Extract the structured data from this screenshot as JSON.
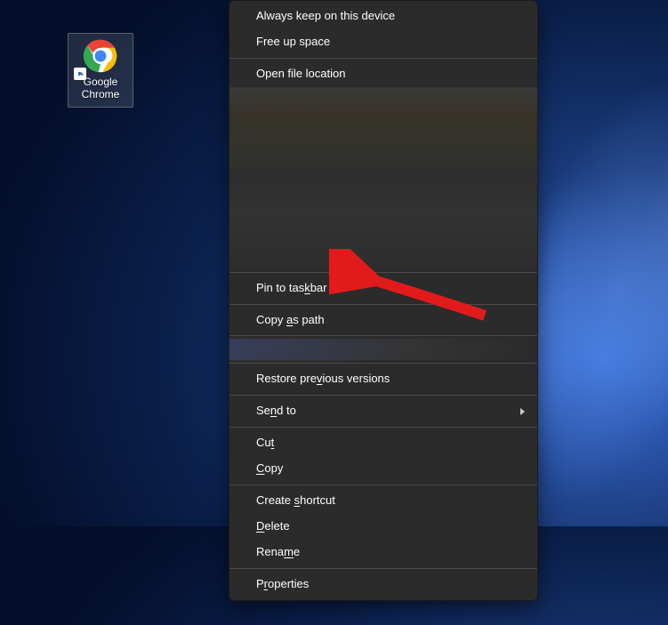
{
  "desktop": {
    "icon_label_line1": "Google",
    "icon_label_line2": "Chrome"
  },
  "context_menu": {
    "items": [
      {
        "label": "Always keep on this device",
        "mnemonic": null
      },
      {
        "label": "Free up space",
        "mnemonic": null
      },
      "sep",
      {
        "label": "Open file location",
        "mnemonic": null
      },
      "blur",
      "sep",
      {
        "label": "Pin to taskbar",
        "mnemonic": "k"
      },
      "sep",
      {
        "label": "Copy as path",
        "mnemonic": "a"
      },
      "sep",
      "blur-small",
      "sep",
      {
        "label": "Restore previous versions",
        "mnemonic": "v"
      },
      "sep",
      {
        "label": "Send to",
        "mnemonic": "n",
        "submenu": true
      },
      "sep",
      {
        "label": "Cut",
        "mnemonic": "t"
      },
      {
        "label": "Copy",
        "mnemonic": "C"
      },
      "sep",
      {
        "label": "Create shortcut",
        "mnemonic": "s"
      },
      {
        "label": "Delete",
        "mnemonic": "D"
      },
      {
        "label": "Rename",
        "mnemonic": "m"
      },
      "sep",
      {
        "label": "Properties",
        "mnemonic": "r"
      }
    ]
  },
  "annotation": {
    "arrow_color": "#e11b1b"
  }
}
